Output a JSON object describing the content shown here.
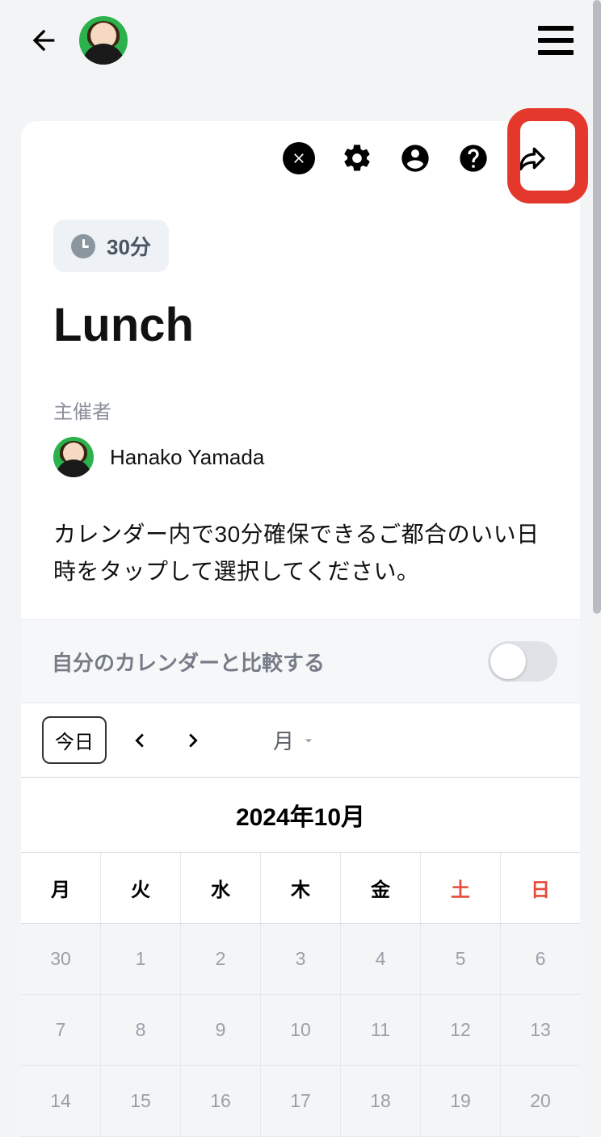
{
  "header": {},
  "event": {
    "duration_label": "30分",
    "title": "Lunch",
    "host_label": "主催者",
    "host_name": "Hanako Yamada",
    "instruction": "カレンダー内で30分確保できるご都合のいい日時をタップして選択してください。"
  },
  "compare": {
    "label": "自分のカレンダーと比較する"
  },
  "calendar": {
    "today_label": "今日",
    "view_label": "月",
    "month_title": "2024年10月",
    "weekdays": [
      "月",
      "火",
      "水",
      "木",
      "金",
      "土",
      "日"
    ],
    "rows": [
      [
        "30",
        "1",
        "2",
        "3",
        "4",
        "5",
        "6"
      ],
      [
        "7",
        "8",
        "9",
        "10",
        "11",
        "12",
        "13"
      ],
      [
        "14",
        "15",
        "16",
        "17",
        "18",
        "19",
        "20"
      ]
    ]
  }
}
